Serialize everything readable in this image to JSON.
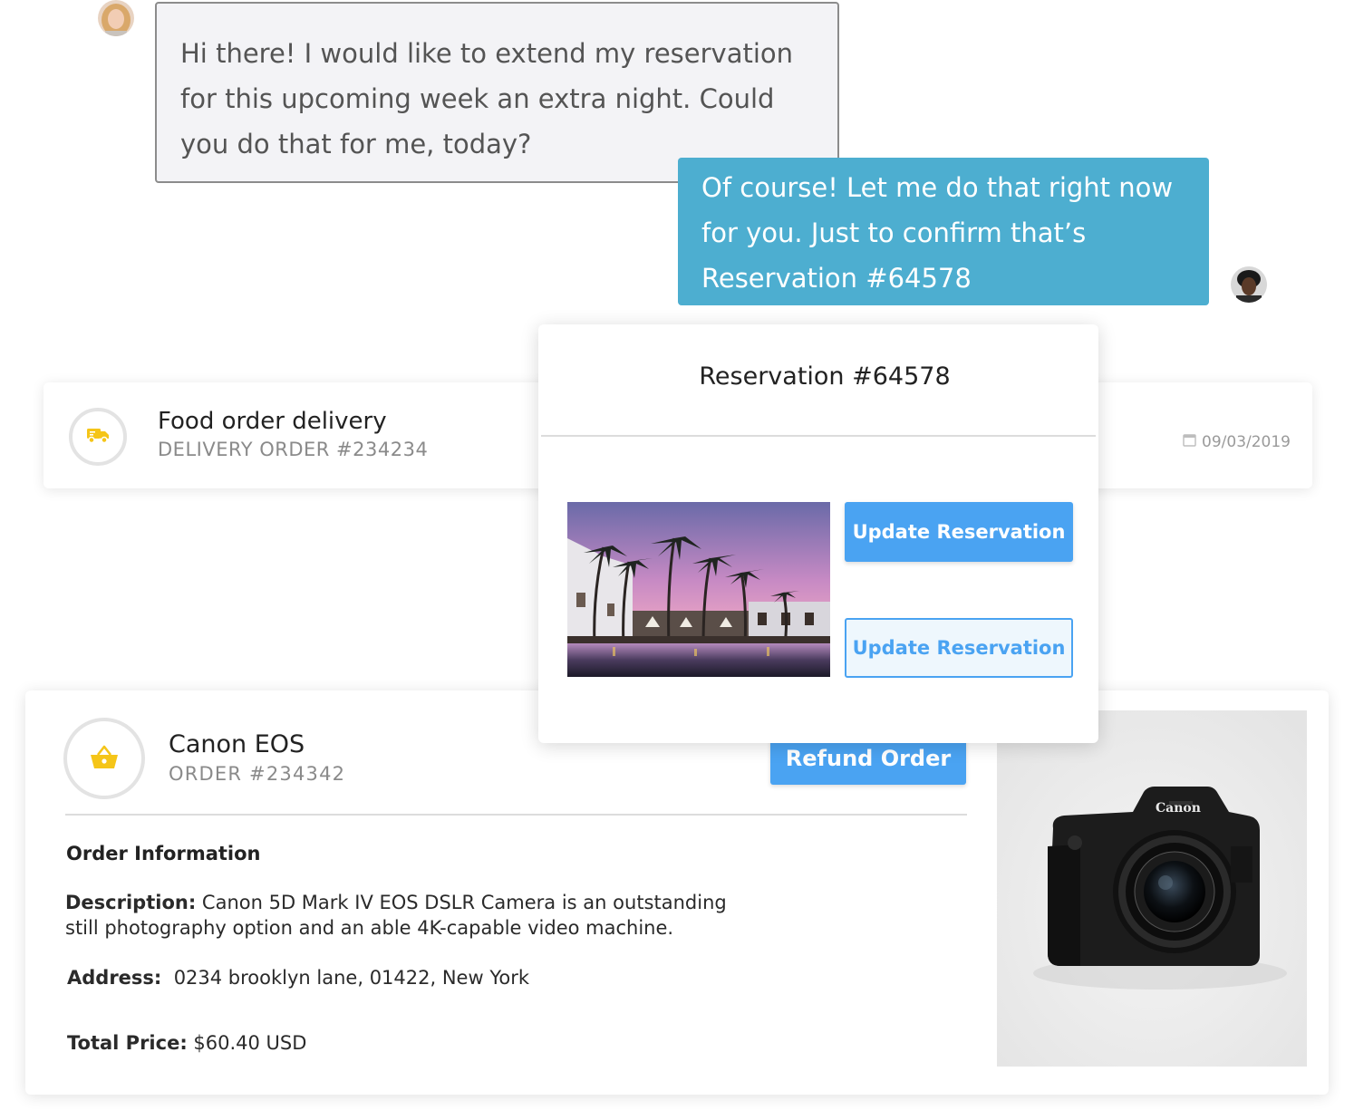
{
  "chat": {
    "customer_message_lines": [
      "Hi there! I would like to extend my reservation",
      "for this upcoming week an extra night. Could",
      "you do that for me, today?"
    ],
    "agent_message_lines": [
      "Of course! Let me do that right now",
      "for you. Just to confirm that’s",
      "Reservation #64578"
    ]
  },
  "delivery": {
    "title": "Food order delivery",
    "subtitle": "DELIVERY ORDER #234234",
    "date": "09/03/2019",
    "icon": "truck-icon"
  },
  "reservation": {
    "title": "Reservation #64578",
    "primary_button": "Update Reservation",
    "secondary_button": "Update Reservation"
  },
  "order": {
    "title": "Canon EOS",
    "subtitle": "ORDER #234342",
    "refund_button": "Refund Order",
    "section_heading": "Order Information",
    "description_label": "Description:",
    "description_lines": [
      "Canon 5D Mark IV EOS DSLR Camera is an outstanding",
      "still photography option and an able 4K-capable video machine."
    ],
    "address_label": "Address:",
    "address": "0234 brooklyn lane, 01422, New York",
    "total_label": "Total Price:",
    "total": "$60.40 USD",
    "icon": "basket-icon",
    "camera_brand": "Canon"
  },
  "colors": {
    "agent_bubble": "#4daed0",
    "customer_bubble": "#f3f3f6",
    "primary_button": "#4aa3f2",
    "icon_yellow": "#f5c518"
  }
}
